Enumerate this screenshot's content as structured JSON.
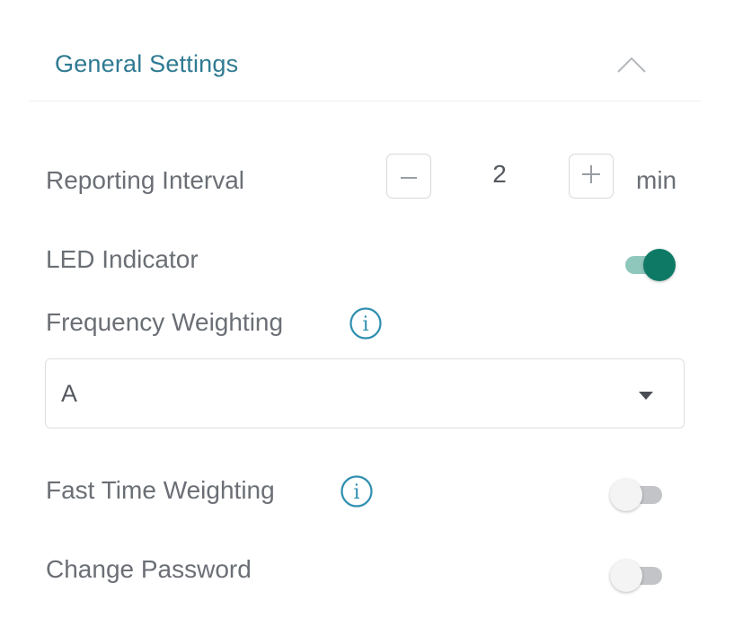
{
  "section": {
    "title": "General Settings",
    "collapse_icon": "chevron-up-icon"
  },
  "reporting_interval": {
    "label": "Reporting Interval",
    "decrement_icon": "minus-icon",
    "value": "2",
    "increment_icon": "plus-icon",
    "unit": "min"
  },
  "led_indicator": {
    "label": "LED Indicator",
    "enabled": true
  },
  "frequency_weighting": {
    "label": "Frequency Weighting",
    "info_icon": "info-icon",
    "selected": "A",
    "dropdown_icon": "caret-down-icon"
  },
  "fast_time_weighting": {
    "label": "Fast Time Weighting",
    "info_icon": "info-icon",
    "enabled": false
  },
  "change_password": {
    "label": "Change Password",
    "enabled": false
  },
  "colors": {
    "title": "#2f7a92",
    "accent": "#0e7a66",
    "accent_light": "#8fc7bc",
    "info": "#2f8fb0",
    "label": "#6b6f75"
  }
}
